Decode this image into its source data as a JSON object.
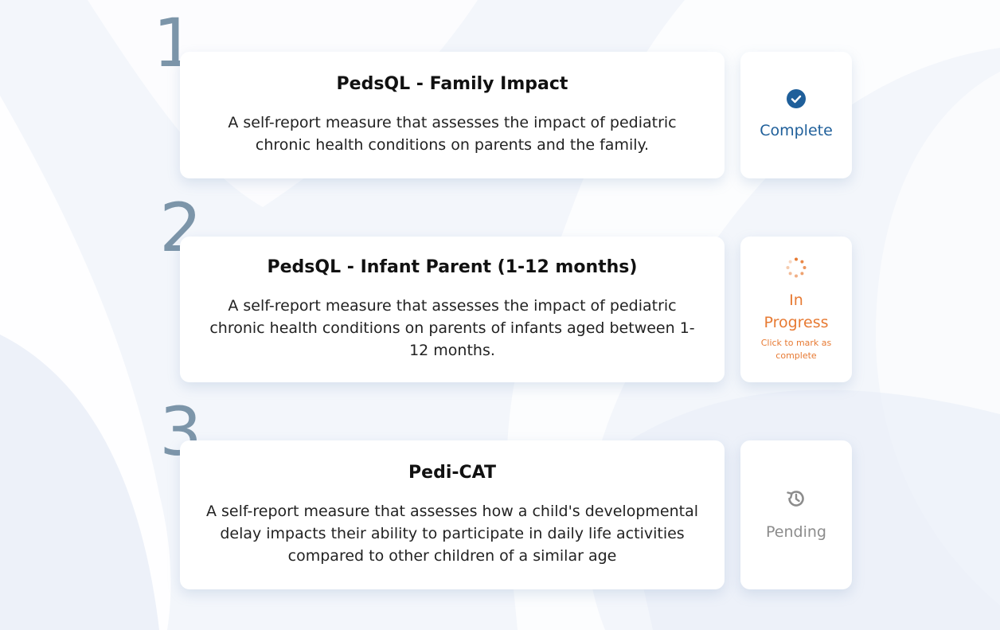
{
  "colors": {
    "complete": "#1f5f9a",
    "in_progress": "#e77a33",
    "pending": "#8c8c8c",
    "step_number": "#7c95a9"
  },
  "steps": [
    {
      "number": "1",
      "title": "PedsQL - Family Impact",
      "description": "A self-report measure that assesses the impact of pediatric chronic health conditions on parents and the family.",
      "status": {
        "icon": "check-circle-icon",
        "label": "Complete"
      }
    },
    {
      "number": "2",
      "title": "PedsQL - Infant Parent (1-12 months)",
      "description": "A self-report measure that assesses the impact of pediatric chronic health conditions on parents of infants aged between 1-12 months.",
      "status": {
        "icon": "spinner-icon",
        "label_line1": "In",
        "label_line2": "Progress",
        "hint": "Click to mark as complete"
      }
    },
    {
      "number": "3",
      "title": "Pedi-CAT",
      "description": "A self-report measure that assesses how a child's developmental delay impacts their ability to participate in daily life activities compared to other children of a similar age",
      "status": {
        "icon": "history-icon",
        "label": "Pending"
      }
    }
  ]
}
